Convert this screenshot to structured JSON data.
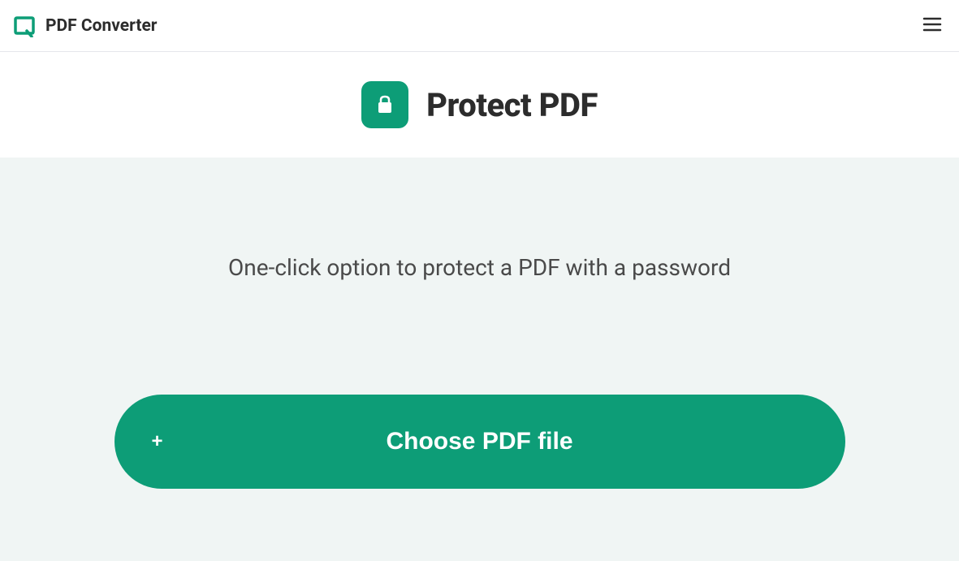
{
  "header": {
    "site_title": "PDF Converter"
  },
  "page": {
    "title": "Protect PDF",
    "description": "One-click option to protect a PDF with a password"
  },
  "actions": {
    "choose_file_label": "Choose PDF file"
  },
  "colors": {
    "primary": "#0d9d77",
    "light_bg": "#f0f5f4",
    "text_dark": "#2c2c2c"
  }
}
